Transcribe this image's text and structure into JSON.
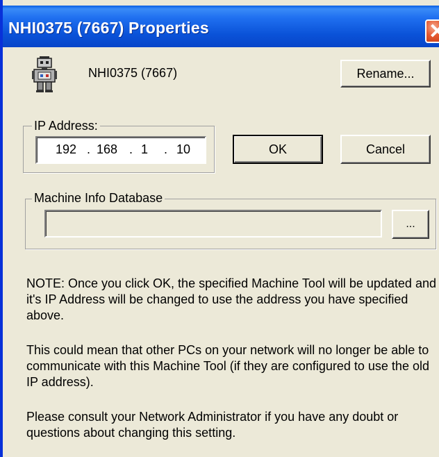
{
  "window": {
    "title": "NHI0375 (7667) Properties",
    "title_bar_color": "#0a52d8",
    "close_symbol": "✕"
  },
  "machine": {
    "icon": "robot-icon",
    "name": "NHI0375 (7667)"
  },
  "buttons": {
    "rename": "Rename...",
    "ok": "OK",
    "cancel": "Cancel",
    "browse": "..."
  },
  "ip_group": {
    "label": "IP Address:",
    "octets": [
      "192",
      "168",
      "1",
      "10"
    ],
    "separators": [
      ".",
      ".",
      "."
    ]
  },
  "db_group": {
    "label": "Machine Info Database",
    "value": ""
  },
  "notes": [
    "NOTE: Once you click OK, the specified Machine Tool will be updated and it's IP Address will be changed to use the address you have specified above.",
    "This could mean that other PCs on your network will no longer be able to communicate with this Machine Tool (if they are configured to use the old IP address).",
    "Please consult your Network Administrator if you have any doubt or questions about changing this setting."
  ]
}
